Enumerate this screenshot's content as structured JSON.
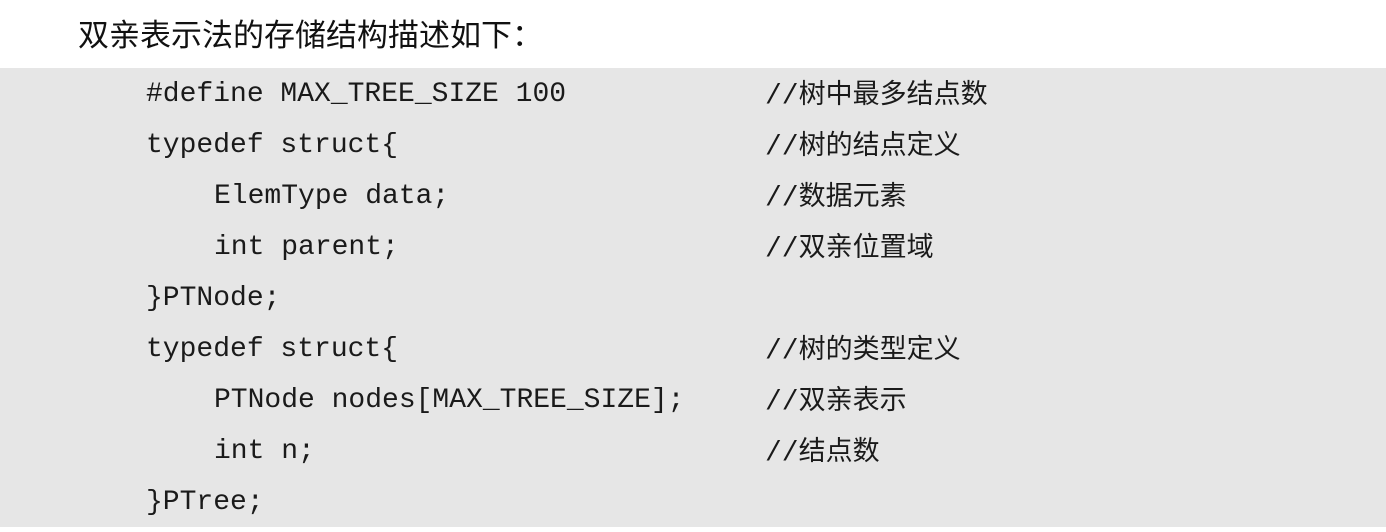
{
  "intro_text": "双亲表示法的存储结构描述如下：",
  "code_lines": [
    {
      "code": "#define MAX_TREE_SIZE 100",
      "indent": 0,
      "comment_prefix": "//",
      "comment_text": "树中最多结点数"
    },
    {
      "code": "typedef struct{",
      "indent": 0,
      "comment_prefix": "//",
      "comment_text": "树的结点定义"
    },
    {
      "code": "ElemType data;",
      "indent": 1,
      "comment_prefix": "//",
      "comment_text": "数据元素"
    },
    {
      "code": "int parent;",
      "indent": 1,
      "comment_prefix": "//",
      "comment_text": "双亲位置域"
    },
    {
      "code": "}PTNode;",
      "indent": 0,
      "comment_prefix": "",
      "comment_text": ""
    },
    {
      "code": "typedef struct{",
      "indent": 0,
      "comment_prefix": "//",
      "comment_text": "树的类型定义"
    },
    {
      "code": "PTNode nodes[MAX_TREE_SIZE];",
      "indent": 1,
      "comment_prefix": "//",
      "comment_text": "双亲表示"
    },
    {
      "code": "int n;",
      "indent": 1,
      "comment_prefix": "//",
      "comment_text": "结点数"
    },
    {
      "code": "}PTree;",
      "indent": 0,
      "comment_prefix": "",
      "comment_text": ""
    }
  ],
  "colors": {
    "code_background": "#e6e6e6",
    "text": "#1a1a1a"
  }
}
